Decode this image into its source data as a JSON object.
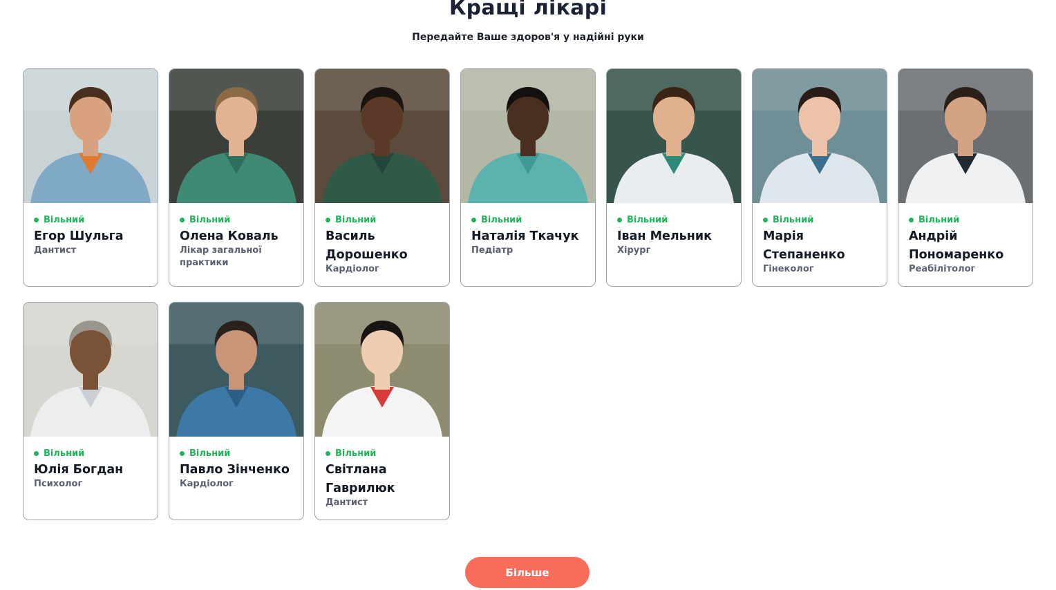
{
  "header": {
    "title": "Кращі лікарі",
    "subtitle": "Передайте Ваше здоров'я у надійні руки"
  },
  "doctors": [
    {
      "status": "Вільний",
      "name": "Егор Шульга",
      "specialty": "Дантист",
      "photo": {
        "bg": "#c9d3d6",
        "skin": "#d9a27e",
        "hair": "#4a2e1e",
        "coat": "#7fa9c4",
        "accent": "#e07a2e"
      }
    },
    {
      "status": "Вільний",
      "name": "Олена Коваль",
      "specialty": "Лікар загальної практики",
      "photo": {
        "bg": "#3b3f3a",
        "skin": "#e2b392",
        "hair": "#8b6a45",
        "coat": "#3f8a74",
        "accent": "#2f6e5c"
      }
    },
    {
      "status": "Вільний",
      "name": "Василь Дорошенко",
      "specialty": "Кардіолог",
      "photo": {
        "bg": "#5a4b3c",
        "skin": "#5a3a26",
        "hair": "#1a1410",
        "coat": "#2f5a48",
        "accent": "#24463a"
      }
    },
    {
      "status": "Вільний",
      "name": "Наталія Ткачук",
      "specialty": "Педіатр",
      "photo": {
        "bg": "#b3b7a6",
        "skin": "#4a2f20",
        "hair": "#151010",
        "coat": "#5cb2ae",
        "accent": "#3f9995"
      }
    },
    {
      "status": "Вільний",
      "name": "Іван Мельник",
      "specialty": "Хірург",
      "photo": {
        "bg": "#37554c",
        "skin": "#e0b08f",
        "hair": "#3a2416",
        "coat": "#e9edf0",
        "accent": "#2d8a78"
      }
    },
    {
      "status": "Вільний",
      "name": "Марія Степаненко",
      "specialty": "Гінеколог",
      "photo": {
        "bg": "#6f8f96",
        "skin": "#ecc3a8",
        "hair": "#2a1d17",
        "coat": "#dfe6ec",
        "accent": "#3a6f8e"
      }
    },
    {
      "status": "Вільний",
      "name": "Андрій Пономаренко",
      "specialty": "Реабілітолог",
      "photo": {
        "bg": "#6b6f72",
        "skin": "#d4a384",
        "hair": "#2b1f19",
        "coat": "#eef0f1",
        "accent": "#202a33"
      }
    },
    {
      "status": "Вільний",
      "name": "Юлія Богдан",
      "specialty": "Психолог",
      "photo": {
        "bg": "#d7d6d0",
        "skin": "#7a5238",
        "hair": "#9a968e",
        "coat": "#eceeee",
        "accent": "#c9cfd4"
      }
    },
    {
      "status": "Вільний",
      "name": "Павло Зінченко",
      "specialty": "Кардіолог",
      "photo": {
        "bg": "#3d5a60",
        "skin": "#c99576",
        "hair": "#2a211b",
        "coat": "#3d79a6",
        "accent": "#2c5f86"
      }
    },
    {
      "status": "Вільний",
      "name": "Світлана Гаврилюк",
      "specialty": "Дантист",
      "photo": {
        "bg": "#8e8c70",
        "skin": "#efcdb0",
        "hair": "#1a1412",
        "coat": "#f4f4f4",
        "accent": "#d83a3a"
      }
    }
  ],
  "more_button": {
    "label": "Більше"
  },
  "colors": {
    "accent": "#f96d5a",
    "available": "#22b45a"
  }
}
